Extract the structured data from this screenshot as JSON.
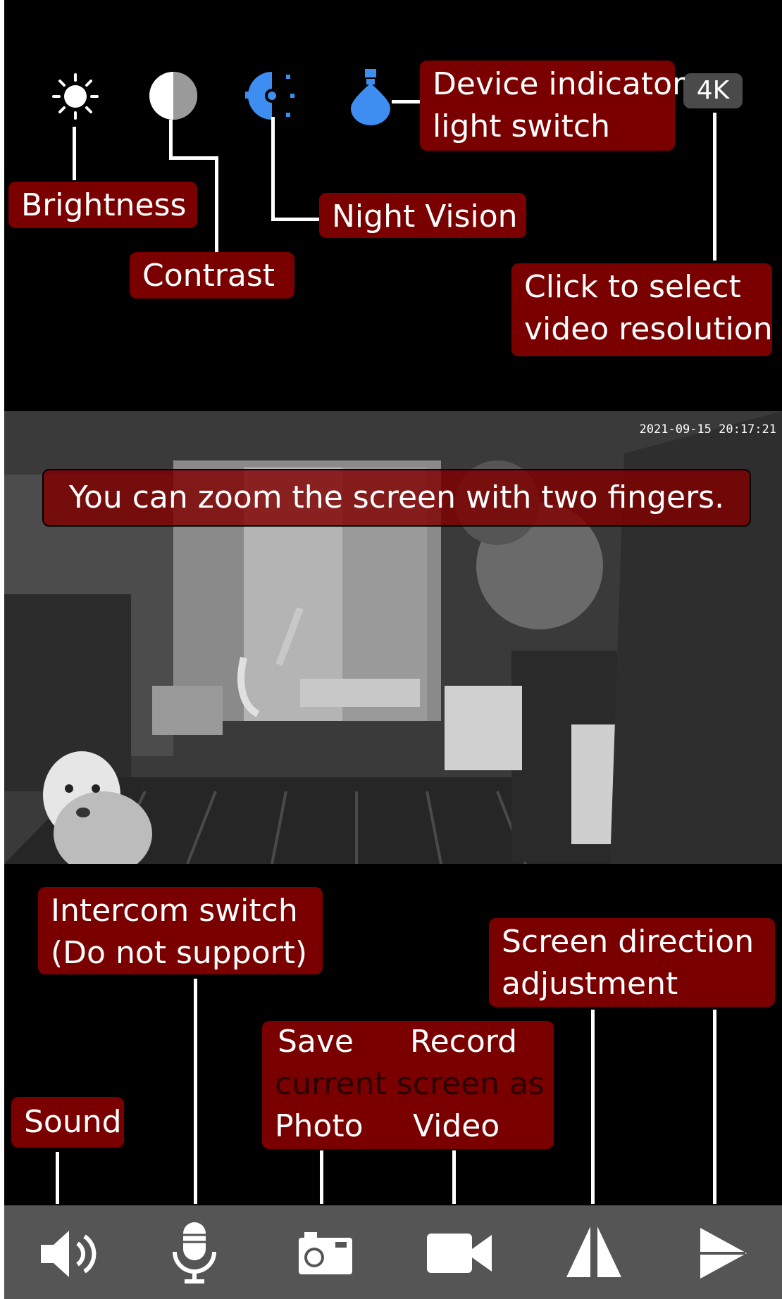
{
  "top_controls": {
    "brightness_label": "Brightness",
    "contrast_label": "Contrast",
    "night_vision_label": "Night Vision",
    "indicator_label_line1": "Device indicator",
    "indicator_label_line2": "light switch",
    "resolution_badge": "4K",
    "resolution_label_line1": "Click to select",
    "resolution_label_line2": "video resolution"
  },
  "video": {
    "timestamp": "2021-09-15 20:17:21",
    "zoom_tip": "You can zoom the screen with two fingers."
  },
  "bottom_callouts": {
    "intercom_line1": "Intercom switch",
    "intercom_line2": "(Do not support)",
    "direction_line1": "Screen direction",
    "direction_line2": "adjustment",
    "save_word": "Save",
    "record_word": "Record",
    "current_screen_as": "current screen as",
    "photo_word": "Photo",
    "video_word": "Video",
    "sound_label": "Sound"
  },
  "icons": {
    "brightness": "sun-icon",
    "contrast": "contrast-icon",
    "night_vision": "night-vision-icon",
    "indicator": "bulb-icon",
    "sound": "speaker-icon",
    "intercom": "microphone-icon",
    "photo": "camera-icon",
    "video": "video-camera-icon",
    "flip_vertical": "flip-icon",
    "mirror": "mirror-icon"
  },
  "colors": {
    "callout": "#7a0000",
    "accent_blue": "#3d8ef0",
    "toolbar": "#555555"
  }
}
